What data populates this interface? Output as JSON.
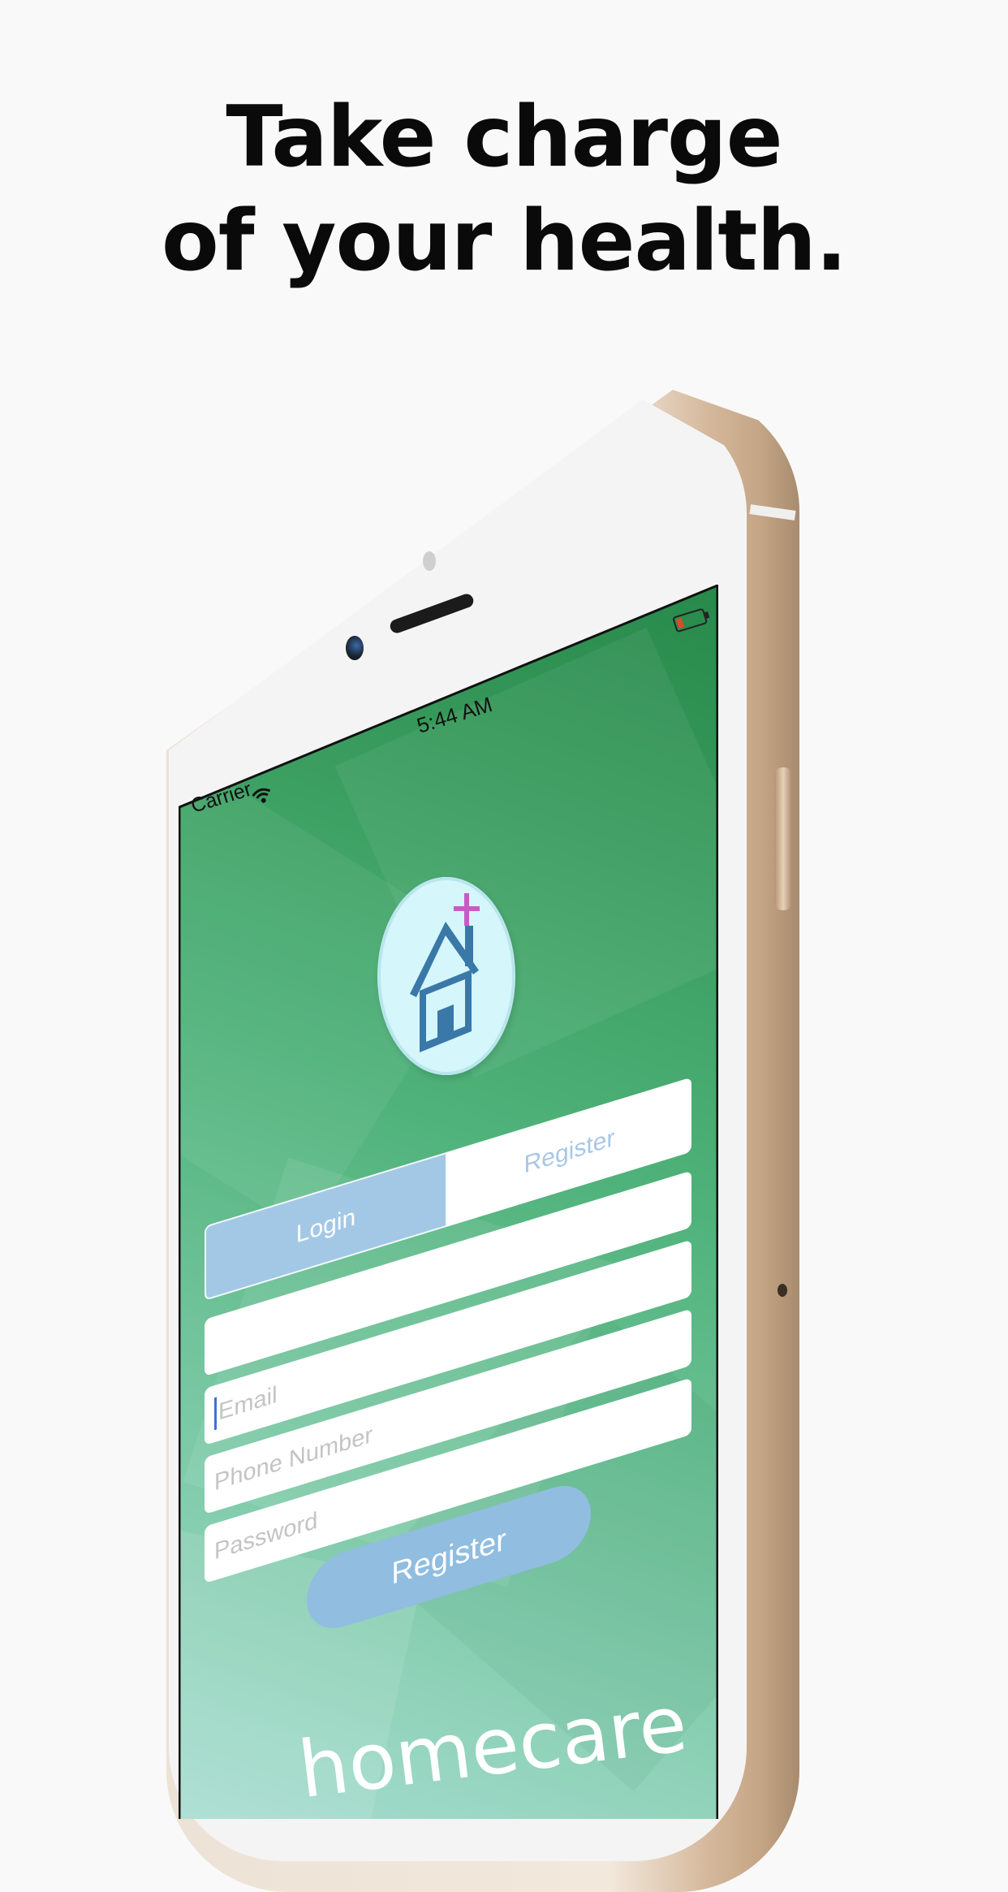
{
  "headline": {
    "line1": "Take charge",
    "line2": "of your health."
  },
  "status_bar": {
    "carrier": "Carrier",
    "time": "5:44 AM"
  },
  "tabs": [
    {
      "label": "Login",
      "selected": true
    },
    {
      "label": "Register",
      "selected": false
    }
  ],
  "form": {
    "blank_field": {
      "value": "",
      "placeholder": ""
    },
    "email": {
      "value": "",
      "placeholder": "Email"
    },
    "phone": {
      "value": "",
      "placeholder": "Phone Number"
    },
    "password": {
      "value": "",
      "placeholder": "Password"
    },
    "submit_label": "Register"
  },
  "brand": "homecare",
  "icons": {
    "logo": "house-with-medical-cross-icon",
    "wifi": "wifi-icon",
    "battery": "battery-low-icon"
  },
  "colors": {
    "screen_green": "#3a9d5f",
    "tab_selected": "#a3c8e6",
    "button": "#90bde0",
    "cross": "#c65bc7",
    "house": "#3a78a8",
    "battery_level": "#d94b2b"
  }
}
